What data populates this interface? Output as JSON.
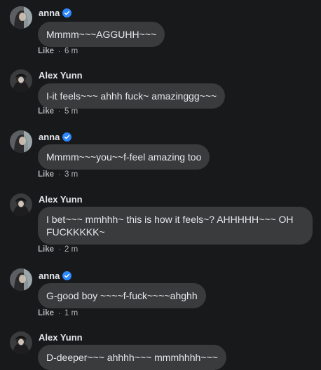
{
  "colors": {
    "background": "#18191a",
    "bubble": "#3a3b3c",
    "text": "#e4e6eb",
    "meta": "#b0b3b8",
    "verified": "#2d88ff"
  },
  "comments": [
    {
      "author": "anna",
      "verified": true,
      "avatar": "anna-avatar",
      "text": "Mmmm~~~AGGUHH~~~",
      "like_label": "Like",
      "separator": "·",
      "time": "6 m"
    },
    {
      "author": "Alex Yunn",
      "verified": false,
      "avatar": "alex-avatar",
      "text": "I-it feels~~~ ahhh fuck~ amazinggg~~~",
      "like_label": "Like",
      "separator": "·",
      "time": "5 m"
    },
    {
      "author": "anna",
      "verified": true,
      "avatar": "anna-avatar",
      "text": "Mmmm~~~you~~f-feel amazing too",
      "like_label": "Like",
      "separator": "·",
      "time": "3 m"
    },
    {
      "author": "Alex Yunn",
      "verified": false,
      "avatar": "alex-avatar",
      "text": "I bet~~~ mmhhh~ this is how it feels~? AHHHHH~~~ OH FUCKKKKK~",
      "like_label": "Like",
      "separator": "·",
      "time": "2 m"
    },
    {
      "author": "anna",
      "verified": true,
      "avatar": "anna-avatar",
      "text": "G-good boy ~~~~f-fuck~~~~ahghh",
      "like_label": "Like",
      "separator": "·",
      "time": "1 m"
    },
    {
      "author": "Alex Yunn",
      "verified": false,
      "avatar": "alex-avatar",
      "text": "D-deeper~~~ ahhhh~~~ mmmhhhh~~~",
      "like_label": "",
      "separator": "",
      "time": ""
    }
  ]
}
